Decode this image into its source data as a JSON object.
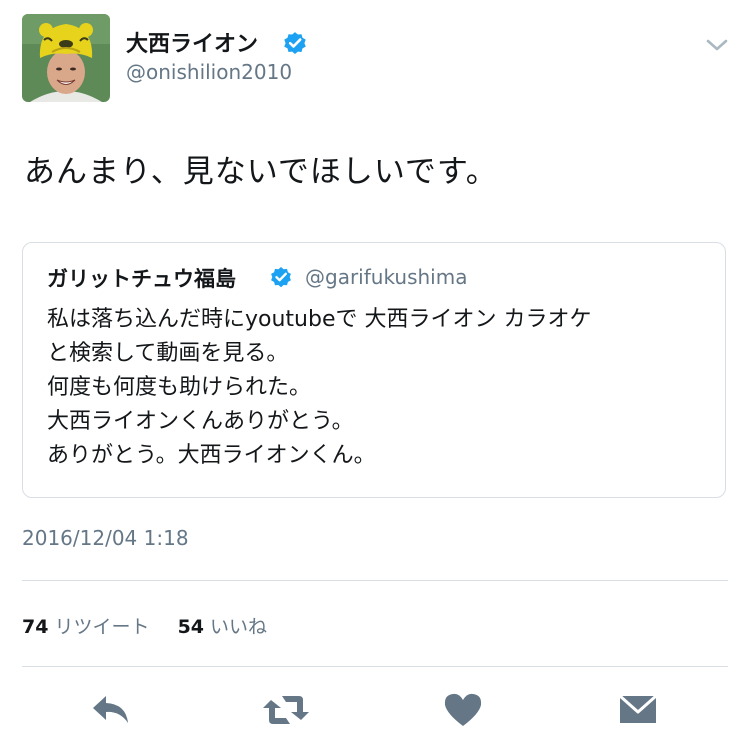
{
  "author": {
    "name": "大西ライオン",
    "handle": "@onishilion2010",
    "verified": true,
    "avatar": "person-with-lion-hat-avatar"
  },
  "tweet": {
    "text": "あんまり、見ないでほしいです。",
    "timestamp": "2016/12/04 1:18"
  },
  "quoted_tweet": {
    "name": "ガリットチュウ福島",
    "handle": "@garifukushima",
    "verified": true,
    "lines": [
      "私は落ち込んだ時にyoutubeで 大西ライオン  カラオケ",
      "と検索して動画を見る。",
      "何度も何度も助けられた。",
      "大西ライオンくんありがとう。",
      "ありがとう。大西ライオンくん。"
    ]
  },
  "stats": {
    "retweets_count": "74",
    "retweets_label": "リツイート",
    "likes_count": "54",
    "likes_label": "いいね"
  },
  "actions": {
    "icons": [
      "reply-icon",
      "retweet-icon",
      "like-icon",
      "direct-message-icon"
    ]
  },
  "colors": {
    "text": "#14171a",
    "secondary": "#657786",
    "verified": "#1da1f2",
    "icon": "#657786",
    "border": "#d8dee3"
  }
}
